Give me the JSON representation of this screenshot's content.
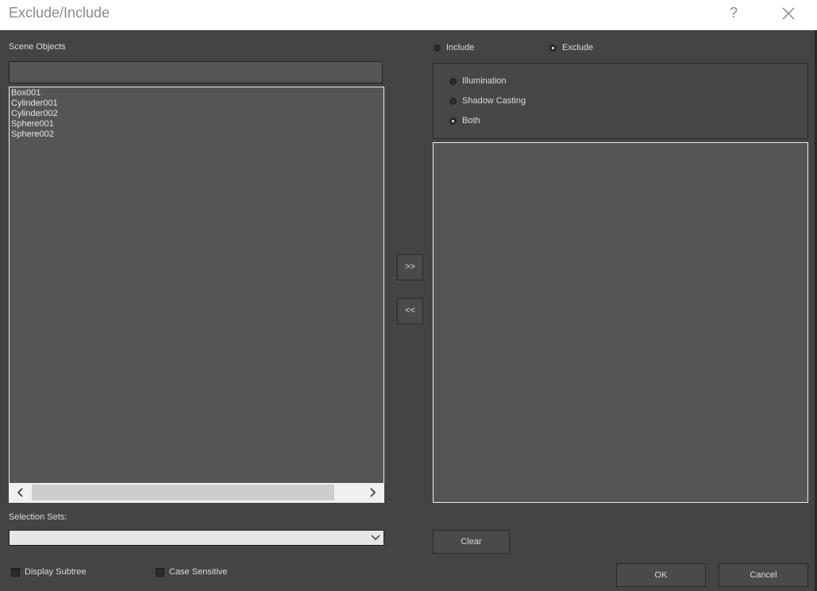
{
  "window": {
    "title": "Exclude/Include",
    "help_label": "?"
  },
  "scene_objects": {
    "label": "Scene Objects",
    "search_value": "",
    "items": [
      "Box001",
      "Cylinder001",
      "Cylinder002",
      "Sphere001",
      "Sphere002"
    ]
  },
  "transfer": {
    "add_label": ">>",
    "remove_label": "<<"
  },
  "mode": {
    "include_label": "Include",
    "exclude_label": "Exclude",
    "selected": "Exclude"
  },
  "exclusion_type": {
    "illumination_label": "Illumination",
    "shadow_casting_label": "Shadow Casting",
    "both_label": "Both",
    "selected": "Both"
  },
  "selection_sets": {
    "label": "Selection Sets:",
    "value": ""
  },
  "options": {
    "display_subtree_label": "Display Subtree",
    "case_sensitive_label": "Case Sensitive"
  },
  "buttons": {
    "clear_label": "Clear",
    "ok_label": "OK",
    "cancel_label": "Cancel"
  },
  "icons": {
    "close": "close-icon",
    "scroll_left": "chevron-left-icon",
    "scroll_right": "chevron-right-icon",
    "dropdown": "chevron-down-icon"
  }
}
